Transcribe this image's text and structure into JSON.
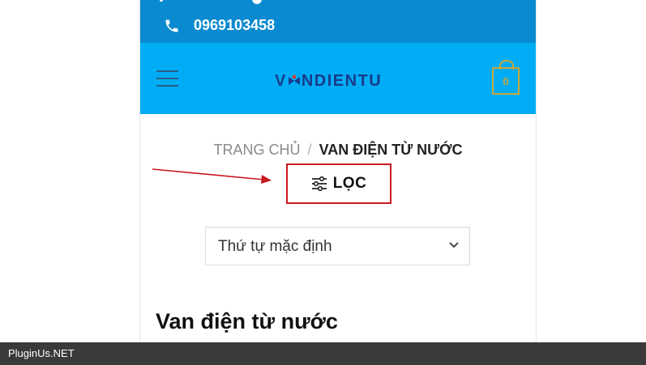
{
  "topbar": {
    "phone_number": "0969103458",
    "phone_icon": "phone-icon"
  },
  "header": {
    "logo_text_start": "V",
    "logo_text_end": "NDIENTU",
    "menu_icon": "hamburger-menu-icon",
    "cart_count": "0",
    "cart_icon": "shopping-bag-icon"
  },
  "breadcrumb": {
    "home": "TRANG CHỦ",
    "separator": "/",
    "current": "VAN ĐIỆN TỪ NƯỚC"
  },
  "filter": {
    "label": "LỌC",
    "icon": "sliders-icon"
  },
  "sort": {
    "selected": "Thứ tự mặc định",
    "icon": "chevron-down-icon"
  },
  "page": {
    "heading": "Van điện từ nước"
  },
  "footer": {
    "watermark": "PluginUs.NET"
  },
  "colors": {
    "topbar": "#0a8ad0",
    "header": "#00adf5",
    "logo": "#1b3a8c",
    "cart": "#c9a638",
    "highlight": "#c8181e",
    "footer": "#3a3a3a"
  }
}
